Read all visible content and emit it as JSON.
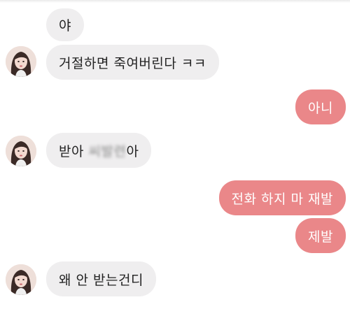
{
  "colors": {
    "incoming_bubble": "#efeeef",
    "outgoing_bubble": "#ea8789",
    "incoming_text": "#222222",
    "outgoing_text": "#ffffff"
  },
  "messages": [
    {
      "direction": "incoming",
      "text": "야",
      "avatar": false
    },
    {
      "direction": "incoming",
      "text": "거절하면 죽여버린다 ㅋㅋ",
      "avatar": true
    },
    {
      "direction": "outgoing",
      "text": "아니"
    },
    {
      "direction": "incoming",
      "text_prefix": "받아 ",
      "text_blurred": "씨발련",
      "text_suffix": "아",
      "avatar": true
    },
    {
      "direction": "outgoing",
      "text": "전화 하지 마 재발"
    },
    {
      "direction": "outgoing",
      "text": "제발"
    },
    {
      "direction": "incoming",
      "text": "왜 안 받는건디",
      "avatar": true
    }
  ],
  "avatar_icon": "profile-photo-girl-long-hair"
}
